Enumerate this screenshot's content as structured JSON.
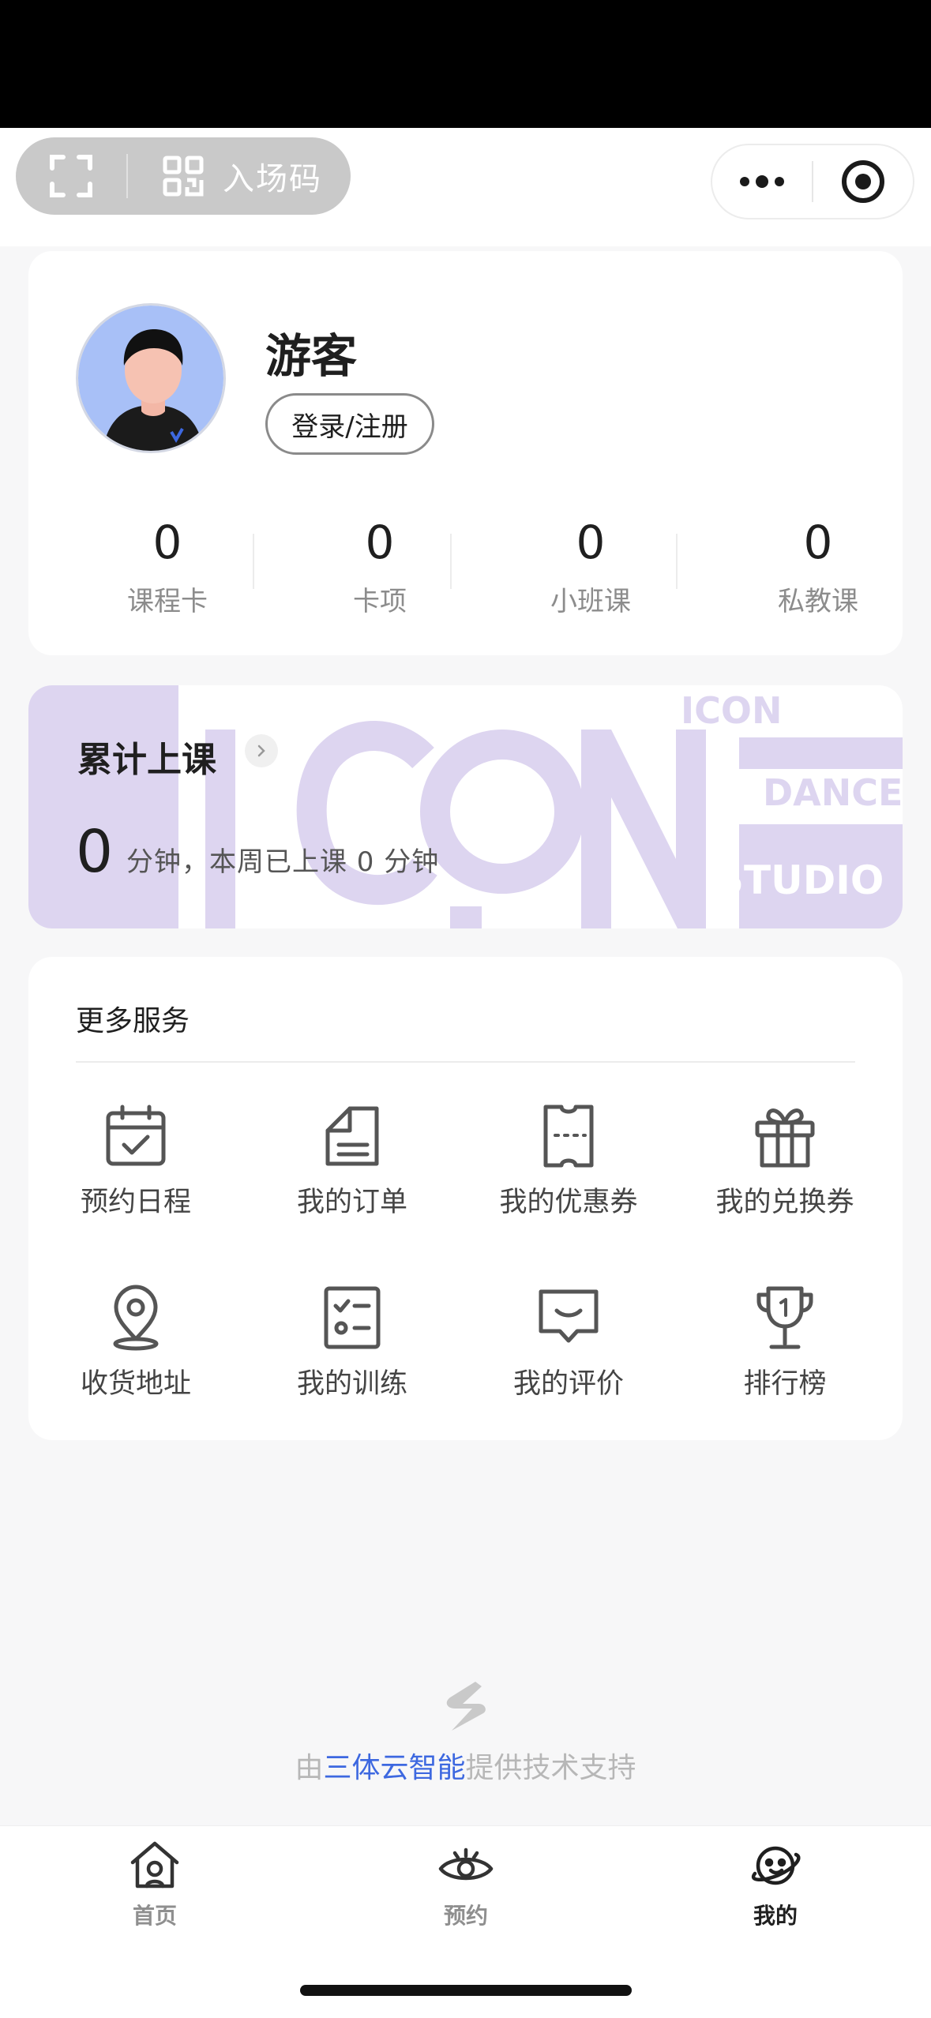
{
  "topbar": {
    "entry_code_label": "入场码"
  },
  "profile": {
    "nickname": "游客",
    "login_label": "登录/注册",
    "stats": [
      {
        "value": "0",
        "label": "课程卡"
      },
      {
        "value": "0",
        "label": "卡项"
      },
      {
        "value": "0",
        "label": "小班课"
      },
      {
        "value": "0",
        "label": "私教课"
      }
    ]
  },
  "banner": {
    "title": "累计上课",
    "minutes": "0",
    "desc": "分钟，本周已上课 0 分钟",
    "watermark": [
      "ICON",
      "DANCE",
      "STUDIO"
    ]
  },
  "services": {
    "title": "更多服务",
    "items": [
      {
        "label": "预约日程",
        "icon": "calendar-check-icon"
      },
      {
        "label": "我的订单",
        "icon": "order-icon"
      },
      {
        "label": "我的优惠券",
        "icon": "coupon-icon"
      },
      {
        "label": "我的兑换券",
        "icon": "gift-icon"
      },
      {
        "label": "收货地址",
        "icon": "location-pin-icon"
      },
      {
        "label": "我的训练",
        "icon": "checklist-icon"
      },
      {
        "label": "我的评价",
        "icon": "comment-icon"
      },
      {
        "label": "排行榜",
        "icon": "trophy-icon"
      }
    ]
  },
  "support": {
    "prefix": "由",
    "brand": "三体云智能",
    "suffix": "提供技术支持"
  },
  "tabbar": {
    "tabs": [
      {
        "label": "首页",
        "icon": "home-icon",
        "active": false
      },
      {
        "label": "预约",
        "icon": "eye-icon",
        "active": false
      },
      {
        "label": "我的",
        "icon": "planet-icon",
        "active": true
      }
    ]
  },
  "colors": {
    "brand_link": "#3d68e0",
    "banner_accent": "#ddd5f0"
  }
}
